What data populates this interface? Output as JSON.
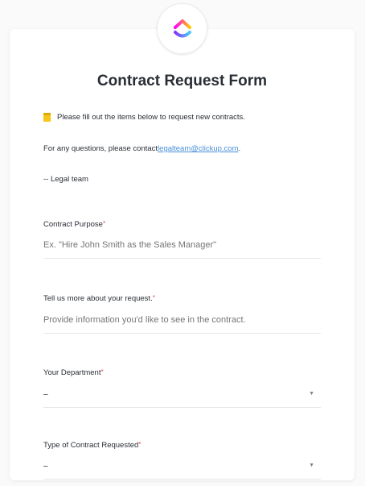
{
  "form": {
    "title": "Contract Request Form",
    "intro": "Please fill out the items below to request new contracts.",
    "questions_prefix": "For any questions, please contact ",
    "contact_email": "legalteam@clickup.com",
    "questions_suffix": ".",
    "signoff": "-- Legal team"
  },
  "fields": {
    "purpose": {
      "label": "Contract Purpose",
      "required_mark": "*",
      "placeholder": "Ex. \"Hire John Smith as the Sales Manager\""
    },
    "request": {
      "label": "Tell us more about your request.",
      "required_mark": "*",
      "placeholder": "Provide information you'd like to see in the contract."
    },
    "department": {
      "label": "Your Department",
      "required_mark": "*",
      "value": "–"
    },
    "contract_type": {
      "label": "Type of Contract Requested",
      "required_mark": "*",
      "value": "–"
    }
  },
  "icons": {
    "logo": "clickup-logo-icon",
    "memo": "memo-icon",
    "dropdown": "chevron-down-icon"
  },
  "colors": {
    "required": "#e5484d",
    "link": "#4a90d9",
    "logo_gradient": [
      "#ff02f0",
      "#ffc800",
      "#7b68ee",
      "#49ccf9"
    ]
  }
}
